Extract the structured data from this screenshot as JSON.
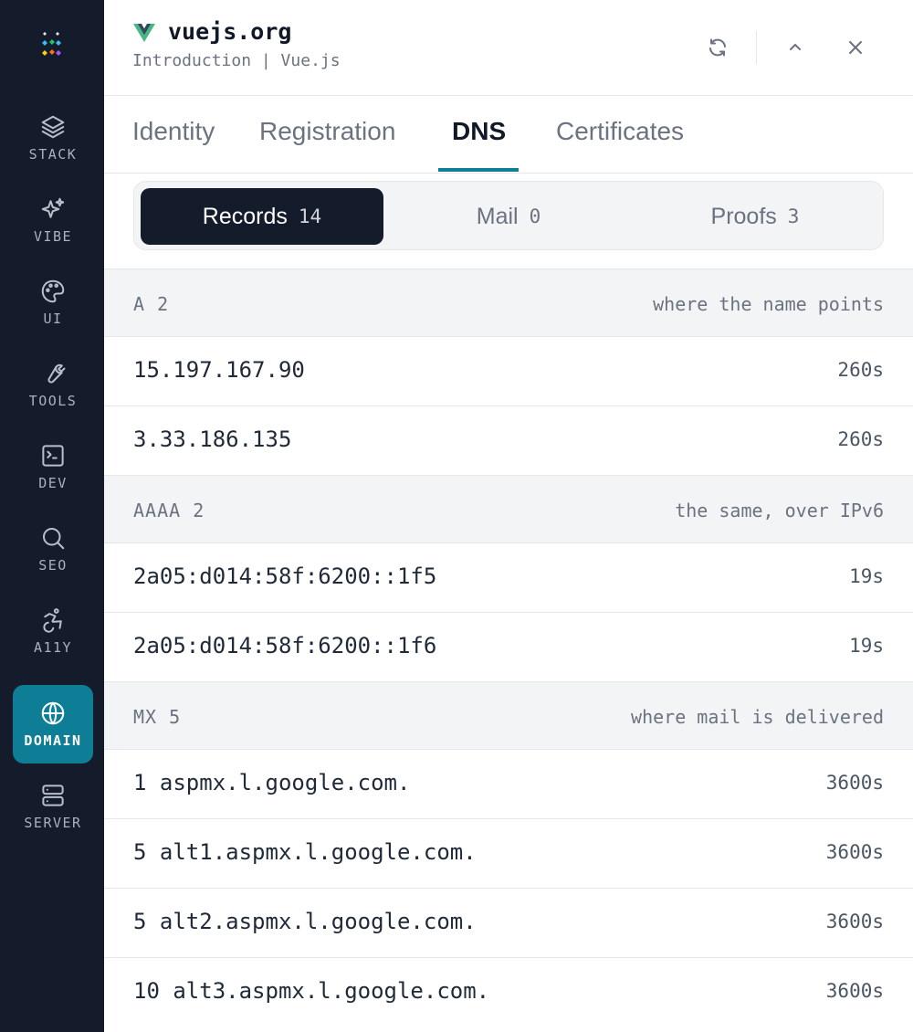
{
  "sidebar": {
    "items": [
      {
        "label": "STACK",
        "icon": "layers-icon"
      },
      {
        "label": "VIBE",
        "icon": "sparkles-icon"
      },
      {
        "label": "UI",
        "icon": "palette-icon"
      },
      {
        "label": "TOOLS",
        "icon": "wrench-icon"
      },
      {
        "label": "DEV",
        "icon": "terminal-icon"
      },
      {
        "label": "SEO",
        "icon": "search-icon"
      },
      {
        "label": "A11Y",
        "icon": "accessibility-icon"
      },
      {
        "label": "DOMAIN",
        "icon": "globe-icon",
        "active": true
      },
      {
        "label": "SERVER",
        "icon": "server-icon"
      }
    ]
  },
  "header": {
    "site": "vuejs.org",
    "page_title": "Introduction | Vue.js"
  },
  "tabs": [
    {
      "label": "Identity"
    },
    {
      "label": "Registration"
    },
    {
      "label": "DNS",
      "active": true
    },
    {
      "label": "Certificates"
    }
  ],
  "segments": [
    {
      "label": "Records",
      "count": "14",
      "active": true
    },
    {
      "label": "Mail",
      "count": "0"
    },
    {
      "label": "Proofs",
      "count": "3"
    }
  ],
  "groups": [
    {
      "name": "A 2",
      "description": "where the name points",
      "records": [
        {
          "value": "15.197.167.90",
          "ttl": "260s"
        },
        {
          "value": "3.33.186.135",
          "ttl": "260s"
        }
      ]
    },
    {
      "name": "AAAA 2",
      "description": "the same, over IPv6",
      "records": [
        {
          "value": "2a05:d014:58f:6200::1f5",
          "ttl": "19s"
        },
        {
          "value": "2a05:d014:58f:6200::1f6",
          "ttl": "19s"
        }
      ]
    },
    {
      "name": "MX 5",
      "description": "where mail is delivered",
      "records": [
        {
          "value": "1 aspmx.l.google.com.",
          "ttl": "3600s"
        },
        {
          "value": "5 alt1.aspmx.l.google.com.",
          "ttl": "3600s"
        },
        {
          "value": "5 alt2.aspmx.l.google.com.",
          "ttl": "3600s"
        },
        {
          "value": "10 alt3.aspmx.l.google.com.",
          "ttl": "3600s"
        }
      ]
    }
  ],
  "colors": {
    "sidebar_bg": "#141b2b",
    "accent": "#0e7e96",
    "vue_green": "#42b883",
    "vue_dark": "#35495e"
  }
}
